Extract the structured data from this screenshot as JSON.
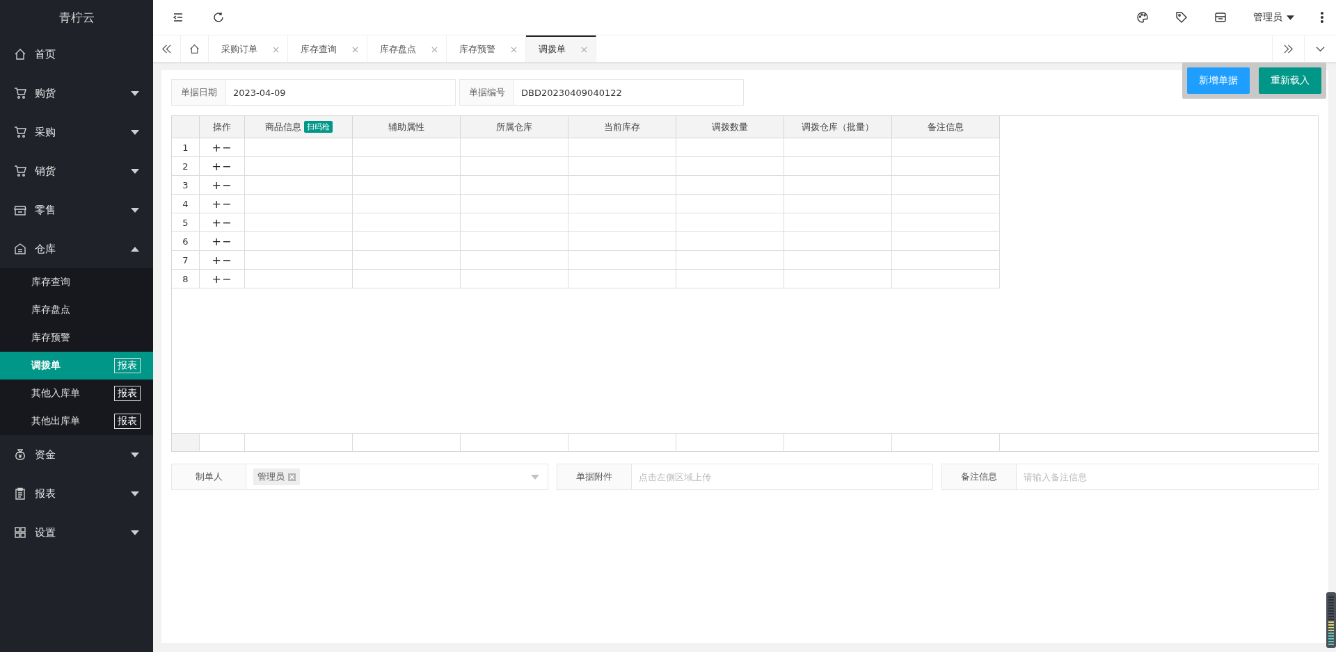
{
  "app": {
    "logo": "青柠云"
  },
  "sidebar": {
    "items": [
      {
        "label": "首页",
        "kind": "link"
      },
      {
        "label": "购货",
        "kind": "group",
        "expanded": false
      },
      {
        "label": "采购",
        "kind": "group",
        "expanded": false
      },
      {
        "label": "销货",
        "kind": "group",
        "expanded": false
      },
      {
        "label": "零售",
        "kind": "group",
        "expanded": false
      },
      {
        "label": "仓库",
        "kind": "group",
        "expanded": true,
        "children": [
          {
            "label": "库存查询",
            "selected": false
          },
          {
            "label": "库存盘点",
            "selected": false
          },
          {
            "label": "库存预警",
            "selected": false
          },
          {
            "label": "调拨单",
            "selected": true,
            "badge": "报表"
          },
          {
            "label": "其他入库单",
            "selected": false,
            "badge": "报表"
          },
          {
            "label": "其他出库单",
            "selected": false,
            "badge": "报表"
          }
        ]
      },
      {
        "label": "资金",
        "kind": "group",
        "expanded": false
      },
      {
        "label": "报表",
        "kind": "group",
        "expanded": false
      },
      {
        "label": "设置",
        "kind": "group",
        "expanded": false
      }
    ]
  },
  "topbar": {
    "user": "管理员"
  },
  "tabs": [
    {
      "label": "采购订单",
      "selected": false
    },
    {
      "label": "库存查询",
      "selected": false
    },
    {
      "label": "库存盘点",
      "selected": false
    },
    {
      "label": "库存预警",
      "selected": false
    },
    {
      "label": "调拨单",
      "selected": true
    }
  ],
  "form": {
    "fields": [
      {
        "label": "单据日期",
        "value": "2023-04-09"
      },
      {
        "label": "单据编号",
        "value": "DBD20230409040122"
      }
    ]
  },
  "buttons": [
    {
      "label": "新增单据",
      "kind": "primary"
    },
    {
      "label": "重新载入",
      "kind": "success"
    }
  ],
  "table": {
    "columns": [
      {
        "label": "操作"
      },
      {
        "label": "商品信息",
        "badge": "扫码枪"
      },
      {
        "label": "辅助属性"
      },
      {
        "label": "所属仓库"
      },
      {
        "label": "当前库存"
      },
      {
        "label": "调拨数量"
      },
      {
        "label": "调拨仓库（批量）"
      },
      {
        "label": "备注信息"
      }
    ],
    "rows": [
      {
        "no": "1",
        "actions": "+−"
      },
      {
        "no": "2",
        "actions": "+−"
      },
      {
        "no": "3",
        "actions": "+−"
      },
      {
        "no": "4",
        "actions": "+−"
      },
      {
        "no": "5",
        "actions": "+−"
      },
      {
        "no": "6",
        "actions": "+−"
      },
      {
        "no": "7",
        "actions": "+−"
      },
      {
        "no": "8",
        "actions": "+−"
      }
    ]
  },
  "footer_fields": {
    "maker": {
      "label": "制单人",
      "tag": "管理员"
    },
    "attachment": {
      "label": "单据附件",
      "placeholder": "点击左侧区域上传"
    },
    "remark": {
      "label": "备注信息",
      "placeholder": "请输入备注信息"
    }
  }
}
